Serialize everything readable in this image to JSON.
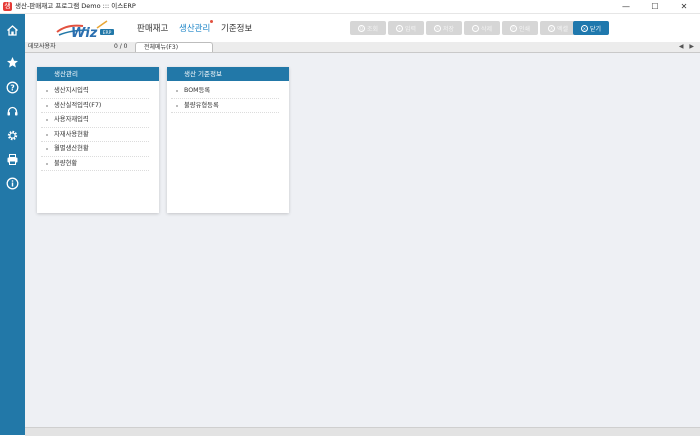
{
  "window": {
    "title": "생산-판매재고 프로그램 Demo ::: 이스ERP",
    "app_icon_glyph": "생",
    "min_glyph": "—",
    "max_glyph": "☐",
    "close_glyph": "✕"
  },
  "sidebar": {
    "icons": [
      "home-icon",
      "star-icon",
      "help-icon",
      "headset-icon",
      "gear-icon",
      "printer-icon",
      "info-icon"
    ]
  },
  "header": {
    "menu": [
      {
        "label": "판매재고",
        "active": false
      },
      {
        "label": "생산관리",
        "active": true
      },
      {
        "label": "기준정보",
        "active": false
      }
    ],
    "toolbar": [
      {
        "label": "조회",
        "glyph": "Q"
      },
      {
        "label": "입력",
        "glyph": "+"
      },
      {
        "label": "저장",
        "glyph": "S"
      },
      {
        "label": "삭제",
        "glyph": "−"
      },
      {
        "label": "인쇄",
        "glyph": "P"
      },
      {
        "label": "엑셀",
        "glyph": "X"
      },
      {
        "label": "닫기",
        "glyph": "×"
      }
    ],
    "accent_color": "#2278a8",
    "active_menu_color": "#1e86c8",
    "dot_color": "#e2513f"
  },
  "subbar": {
    "user": "데모사용자",
    "count": "0 / 0",
    "tab_label": "전체메뉴(F3)",
    "arrows": "◀ ▶"
  },
  "panels": [
    {
      "title": "생산관리",
      "items": [
        "생산지시입력",
        "생산실적입력(F7)",
        "사용자재입력",
        "자재사용현황",
        "월별생산현황",
        "불량현황"
      ]
    },
    {
      "title": "생산 기준정보",
      "items": [
        "BOM등록",
        "불량유형등록"
      ]
    }
  ]
}
